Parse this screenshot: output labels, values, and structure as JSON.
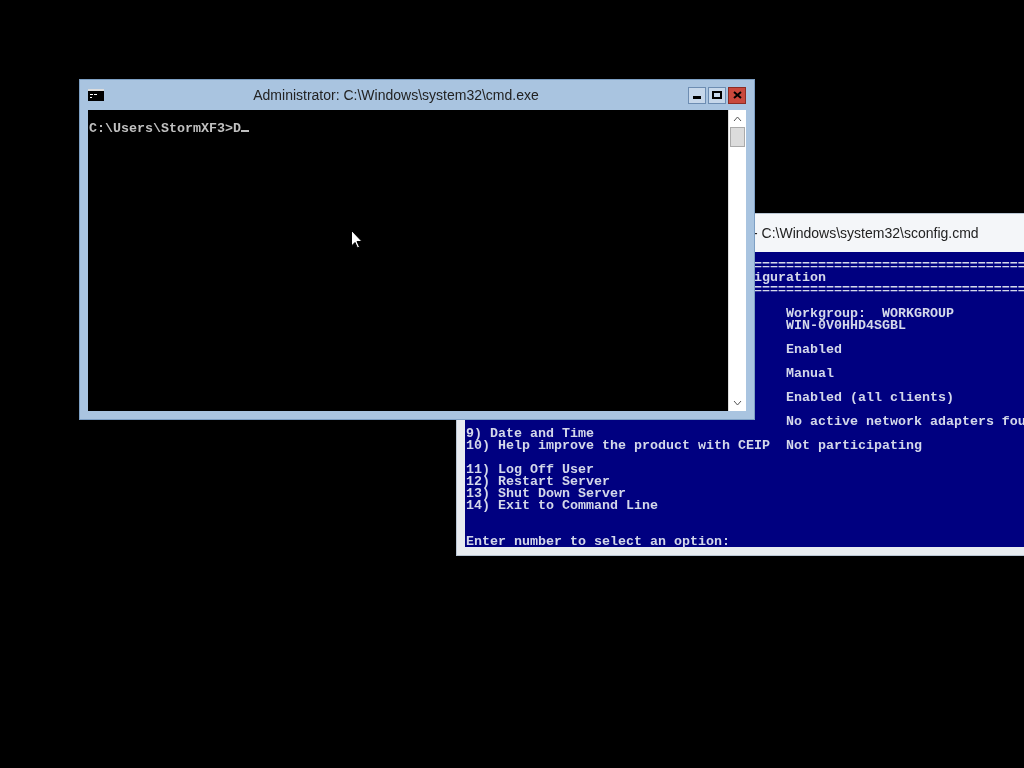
{
  "windows": [
    {
      "kind": "console",
      "title": "- C:\\Windows\\system32\\sconfig.cmd",
      "active": false,
      "lines": [
        {
          "kind": "rule",
          "text": "=================================="
        },
        {
          "kind": "heading",
          "text": "iguration"
        },
        {
          "kind": "rule",
          "text": "=================================="
        },
        {
          "kind": "blank"
        },
        {
          "kind": "value",
          "value": "Workgroup:  WORKGROUP"
        },
        {
          "kind": "value",
          "value": "WIN-0V0HHD4SGBL"
        },
        {
          "kind": "blank"
        },
        {
          "kind": "value",
          "value": "Enabled"
        },
        {
          "kind": "blank"
        },
        {
          "kind": "value",
          "value": "Manual"
        },
        {
          "kind": "blank"
        },
        {
          "kind": "value",
          "value": "Enabled (all clients)"
        },
        {
          "kind": "blank"
        },
        {
          "kind": "value",
          "value": "No active network adapters fou"
        },
        {
          "kind": "option",
          "text": "9) Date and Time"
        },
        {
          "kind": "option",
          "text": "10) Help improve the product with CEIP",
          "value": "Not participating"
        },
        {
          "kind": "blank"
        },
        {
          "kind": "option",
          "text": "11) Log Off User"
        },
        {
          "kind": "option",
          "text": "12) Restart Server"
        },
        {
          "kind": "option",
          "text": "13) Shut Down Server"
        },
        {
          "kind": "option",
          "text": "14) Exit to Command Line"
        },
        {
          "kind": "blank"
        },
        {
          "kind": "blank"
        },
        {
          "kind": "option",
          "text": "Enter number to select an option:"
        }
      ]
    },
    {
      "kind": "cmd",
      "title": "Administrator: C:\\Windows\\system32\\cmd.exe",
      "active": true,
      "lines": [
        {
          "kind": "prompt",
          "text": "C:\\Users\\StormXF3>D"
        }
      ]
    }
  ]
}
